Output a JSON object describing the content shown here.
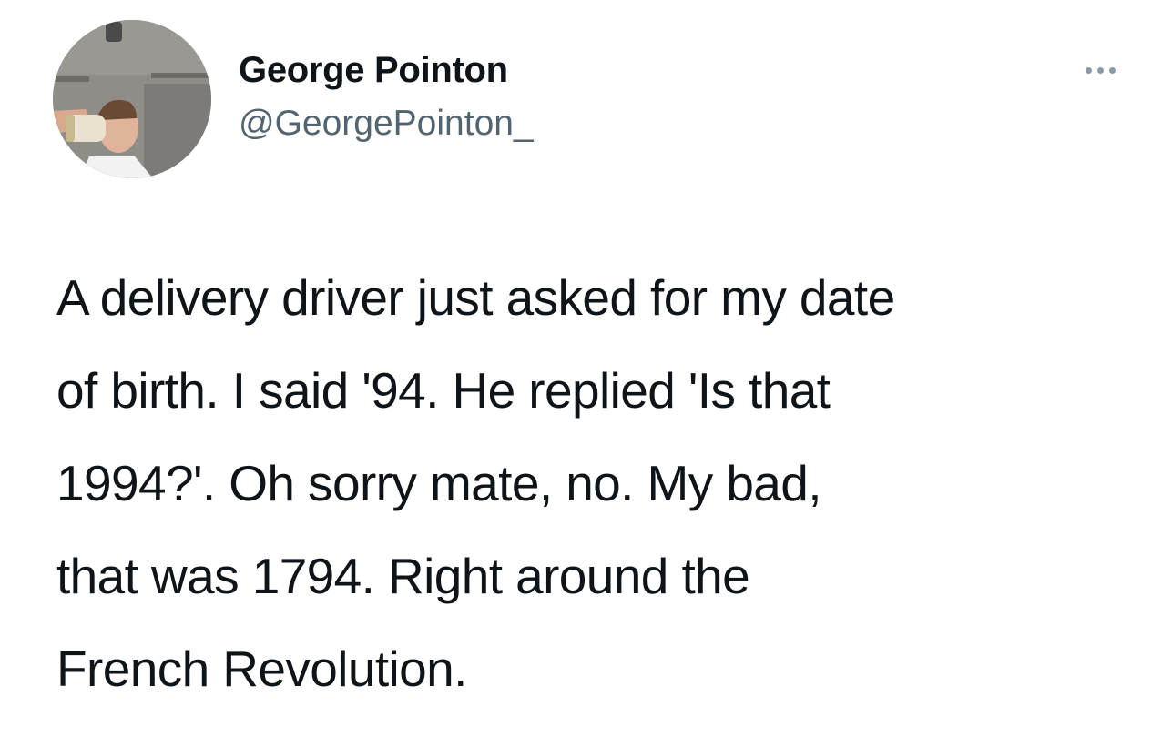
{
  "tweet": {
    "author": {
      "display_name": "George Pointon",
      "handle": "@GeorgePointon_",
      "avatar_icon": "profile-photo-drinking"
    },
    "more_icon": "more-horizontal-icon",
    "text_lines": [
      "A delivery driver just asked for my date",
      "of birth. I said '94. He replied 'Is that",
      "1994?'. Oh sorry mate, no. My bad,",
      "that was 1794. Right around the",
      "French Revolution."
    ]
  },
  "colors": {
    "text_primary": "#0f1419",
    "text_secondary": "#536471",
    "icon_gray": "#8b98a5",
    "background": "#ffffff"
  }
}
